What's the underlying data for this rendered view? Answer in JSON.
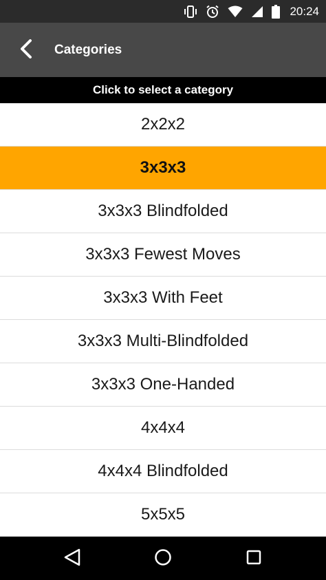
{
  "status_bar": {
    "time": "20:24",
    "icons": [
      "vibrate-icon",
      "alarm-icon",
      "wifi-icon",
      "signal-icon",
      "battery-icon"
    ]
  },
  "app_bar": {
    "title": "Categories",
    "back_icon": "chevron-left-icon",
    "background": "#484848"
  },
  "sub_header": {
    "text": "Click to select a category"
  },
  "categories": [
    {
      "label": "2x2x2",
      "selected": false
    },
    {
      "label": "3x3x3",
      "selected": true
    },
    {
      "label": "3x3x3 Blindfolded",
      "selected": false
    },
    {
      "label": "3x3x3 Fewest Moves",
      "selected": false
    },
    {
      "label": "3x3x3 With Feet",
      "selected": false
    },
    {
      "label": "3x3x3 Multi-Blindfolded",
      "selected": false
    },
    {
      "label": "3x3x3 One-Handed",
      "selected": false
    },
    {
      "label": "4x4x4",
      "selected": false
    },
    {
      "label": "4x4x4 Blindfolded",
      "selected": false
    },
    {
      "label": "5x5x5",
      "selected": false
    }
  ],
  "colors": {
    "selected_background": "#ffa500",
    "status_bar": "#2b2b2b",
    "sub_header": "#000000"
  },
  "nav_bar": {
    "icons": [
      "back-triangle-icon",
      "home-circle-icon",
      "recents-square-icon"
    ]
  }
}
